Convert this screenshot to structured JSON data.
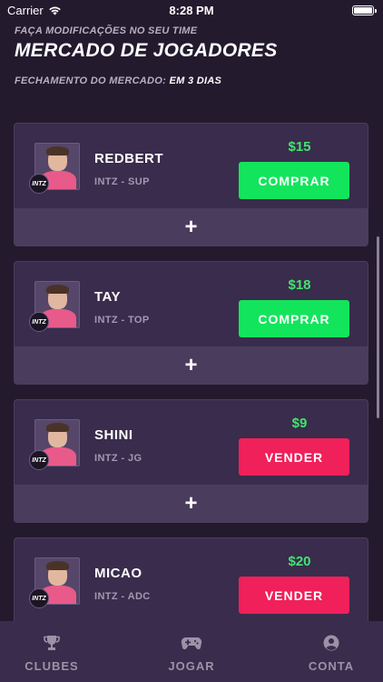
{
  "status_bar": {
    "carrier": "Carrier",
    "time": "8:28 PM"
  },
  "header": {
    "subtitle": "FAÇA MODIFICAÇÕES NO SEU TIME",
    "title": "MERCADO DE JOGADORES",
    "closing_label": "FECHAMENTO DO MERCADO:",
    "closing_value": "EM 3 DIAS"
  },
  "players": [
    {
      "name": "REDBERT",
      "info": "INTZ - SUP",
      "price": "$15",
      "action": "COMPRAR",
      "team_logo": "INTZ",
      "expand": "+"
    },
    {
      "name": "TAY",
      "info": "INTZ - TOP",
      "price": "$18",
      "action": "COMPRAR",
      "team_logo": "INTZ",
      "expand": "+"
    },
    {
      "name": "SHINI",
      "info": "INTZ - JG",
      "price": "$9",
      "action": "VENDER",
      "team_logo": "INTZ",
      "expand": "+"
    },
    {
      "name": "MICAO",
      "info": "INTZ - ADC",
      "price": "$20",
      "action": "VENDER",
      "team_logo": "INTZ",
      "expand": "+"
    }
  ],
  "tabs": [
    {
      "label": "CLUBES",
      "icon": "trophy-icon"
    },
    {
      "label": "JOGAR",
      "icon": "gamepad-icon"
    },
    {
      "label": "CONTA",
      "icon": "user-circle-icon"
    }
  ],
  "colors": {
    "background": "#231a2e",
    "card": "#3a2c4c",
    "buy": "#12e55c",
    "sell": "#f0205a",
    "price": "#3fe66e"
  }
}
